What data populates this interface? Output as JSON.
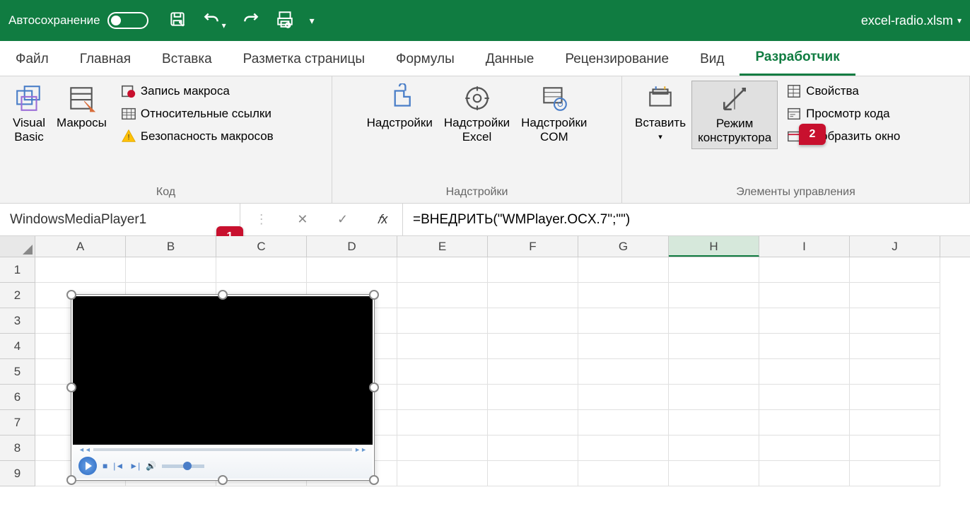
{
  "titlebar": {
    "autosave_label": "Автосохранение",
    "filename": "excel-radio.xlsm"
  },
  "tabs": {
    "items": [
      "Файл",
      "Главная",
      "Вставка",
      "Разметка страницы",
      "Формулы",
      "Данные",
      "Рецензирование",
      "Вид",
      "Разработчик"
    ],
    "active": "Разработчик"
  },
  "ribbon": {
    "code": {
      "visual_basic": "Visual\nBasic",
      "macros": "Макросы",
      "record": "Запись макроса",
      "relative": "Относительные ссылки",
      "security": "Безопасность макросов",
      "group": "Код"
    },
    "addins": {
      "addins": "Надстройки",
      "excel_addins": "Надстройки\nExcel",
      "com_addins": "Надстройки\nCOM",
      "group": "Надстройки"
    },
    "controls": {
      "insert": "Вставить",
      "design": "Режим\nконструктора",
      "properties": "Свойства",
      "view_code": "Просмотр кода",
      "run_dialog": "Отобразить окно",
      "group": "Элементы управления"
    }
  },
  "formulabar": {
    "name": "WindowsMediaPlayer1",
    "fx": "𝑓x",
    "formula": "=ВНЕДРИТЬ(\"WMPlayer.OCX.7\";\"\")"
  },
  "grid": {
    "cols": [
      "A",
      "B",
      "C",
      "D",
      "E",
      "F",
      "G",
      "H",
      "I",
      "J"
    ],
    "selected_col": "H",
    "rows": [
      1,
      2,
      3,
      4,
      5,
      6,
      7,
      8,
      9
    ]
  },
  "callouts": {
    "c1": "1",
    "c2": "2"
  }
}
